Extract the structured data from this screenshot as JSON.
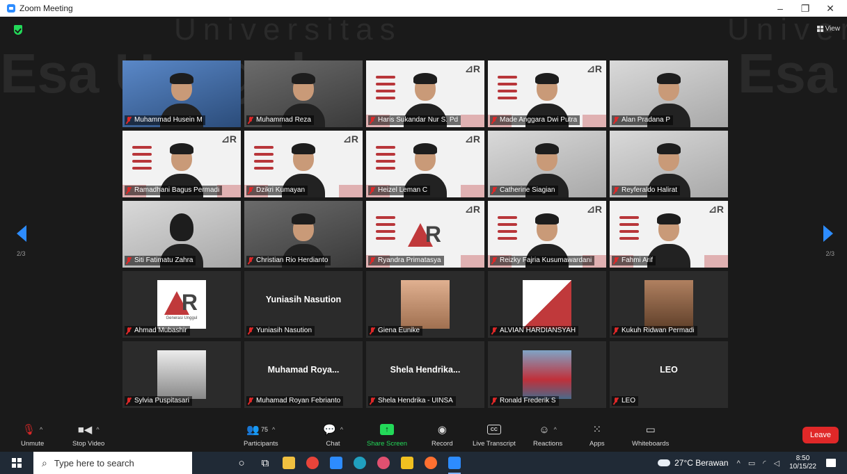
{
  "window": {
    "title": "Zoom Meeting",
    "controls": [
      "–",
      "❐",
      "✕"
    ]
  },
  "background_brand": {
    "line1": "Universitas",
    "line2": "Esa Unggul",
    "right_top": "Univer",
    "right_big": "Esa"
  },
  "view_label": "View",
  "pagination": {
    "left": "2/3",
    "right": "2/3"
  },
  "participants": [
    {
      "name": "Muhammad Husein M",
      "kind": "cam-blue"
    },
    {
      "name": "Muhammad Reza",
      "kind": "cam"
    },
    {
      "name": "Haris Sukandar Nur S. Pd",
      "kind": "slide-person"
    },
    {
      "name": "Made Anggara Dwi Putra",
      "kind": "slide-person"
    },
    {
      "name": "Alan Pradana P",
      "kind": "cam-light"
    },
    {
      "name": "Ramadhani Bagus Permadi",
      "kind": "slide-person"
    },
    {
      "name": "Dzikri Kumayan",
      "kind": "slide-person"
    },
    {
      "name": "Heizel Leman C",
      "kind": "slide-person"
    },
    {
      "name": "Catherine Siagian",
      "kind": "cam-light"
    },
    {
      "name": "Reyferaldo Halirat",
      "kind": "cam-light"
    },
    {
      "name": "Siti Fatimatu Zahra",
      "kind": "cam-hijab"
    },
    {
      "name": "Christian Rio Herdianto",
      "kind": "cam"
    },
    {
      "name": "Ryandra Primatasya",
      "kind": "slide"
    },
    {
      "name": "Reizky Fajria Kusumawardani",
      "kind": "slide-person"
    },
    {
      "name": "Fahmi Arif",
      "kind": "slide-person"
    },
    {
      "name": "Ahmad Mubashir",
      "kind": "avatar-logo",
      "logo_caption": "Generasi Unggul"
    },
    {
      "name": "Yuniasih Nasution",
      "kind": "name-only",
      "display": "Yuniasih Nasution"
    },
    {
      "name": "Giena Eunike",
      "kind": "avatar",
      "photo": "photo1"
    },
    {
      "name": "ALVIAN HARDIANSYAH",
      "kind": "avatar",
      "photo": "photo2"
    },
    {
      "name": "Kukuh Ridwan Permadi",
      "kind": "avatar",
      "photo": "photo3"
    },
    {
      "name": "Sylvia Puspitasari",
      "kind": "avatar",
      "photo": "photo4"
    },
    {
      "name": "Muhamad Royan Febrianto",
      "kind": "name-only",
      "display": "Muhamad  Roya..."
    },
    {
      "name": "Shela Hendrika - UINSA",
      "kind": "name-only",
      "display": "Shela  Hendrika..."
    },
    {
      "name": "Ronald Frederik S",
      "kind": "avatar",
      "photo": "photo5"
    },
    {
      "name": "LEO",
      "kind": "name-only",
      "display": "LEO"
    }
  ],
  "toolbar": {
    "unmute": "Unmute",
    "stop_video": "Stop Video",
    "participants": "Participants",
    "participant_count": "75",
    "chat": "Chat",
    "share_screen": "Share Screen",
    "record": "Record",
    "live_transcript": "Live Transcript",
    "cc": "CC",
    "reactions": "Reactions",
    "apps": "Apps",
    "whiteboards": "Whiteboards",
    "leave": "Leave"
  },
  "taskbar": {
    "search_placeholder": "Type here to search",
    "weather": "27°C  Berawan",
    "time": "8:50",
    "date": "10/15/22"
  },
  "colors": {
    "accent": "#2d8cff",
    "share_green": "#23d959",
    "leave_red": "#e02828",
    "brand_red": "#c0393b"
  }
}
